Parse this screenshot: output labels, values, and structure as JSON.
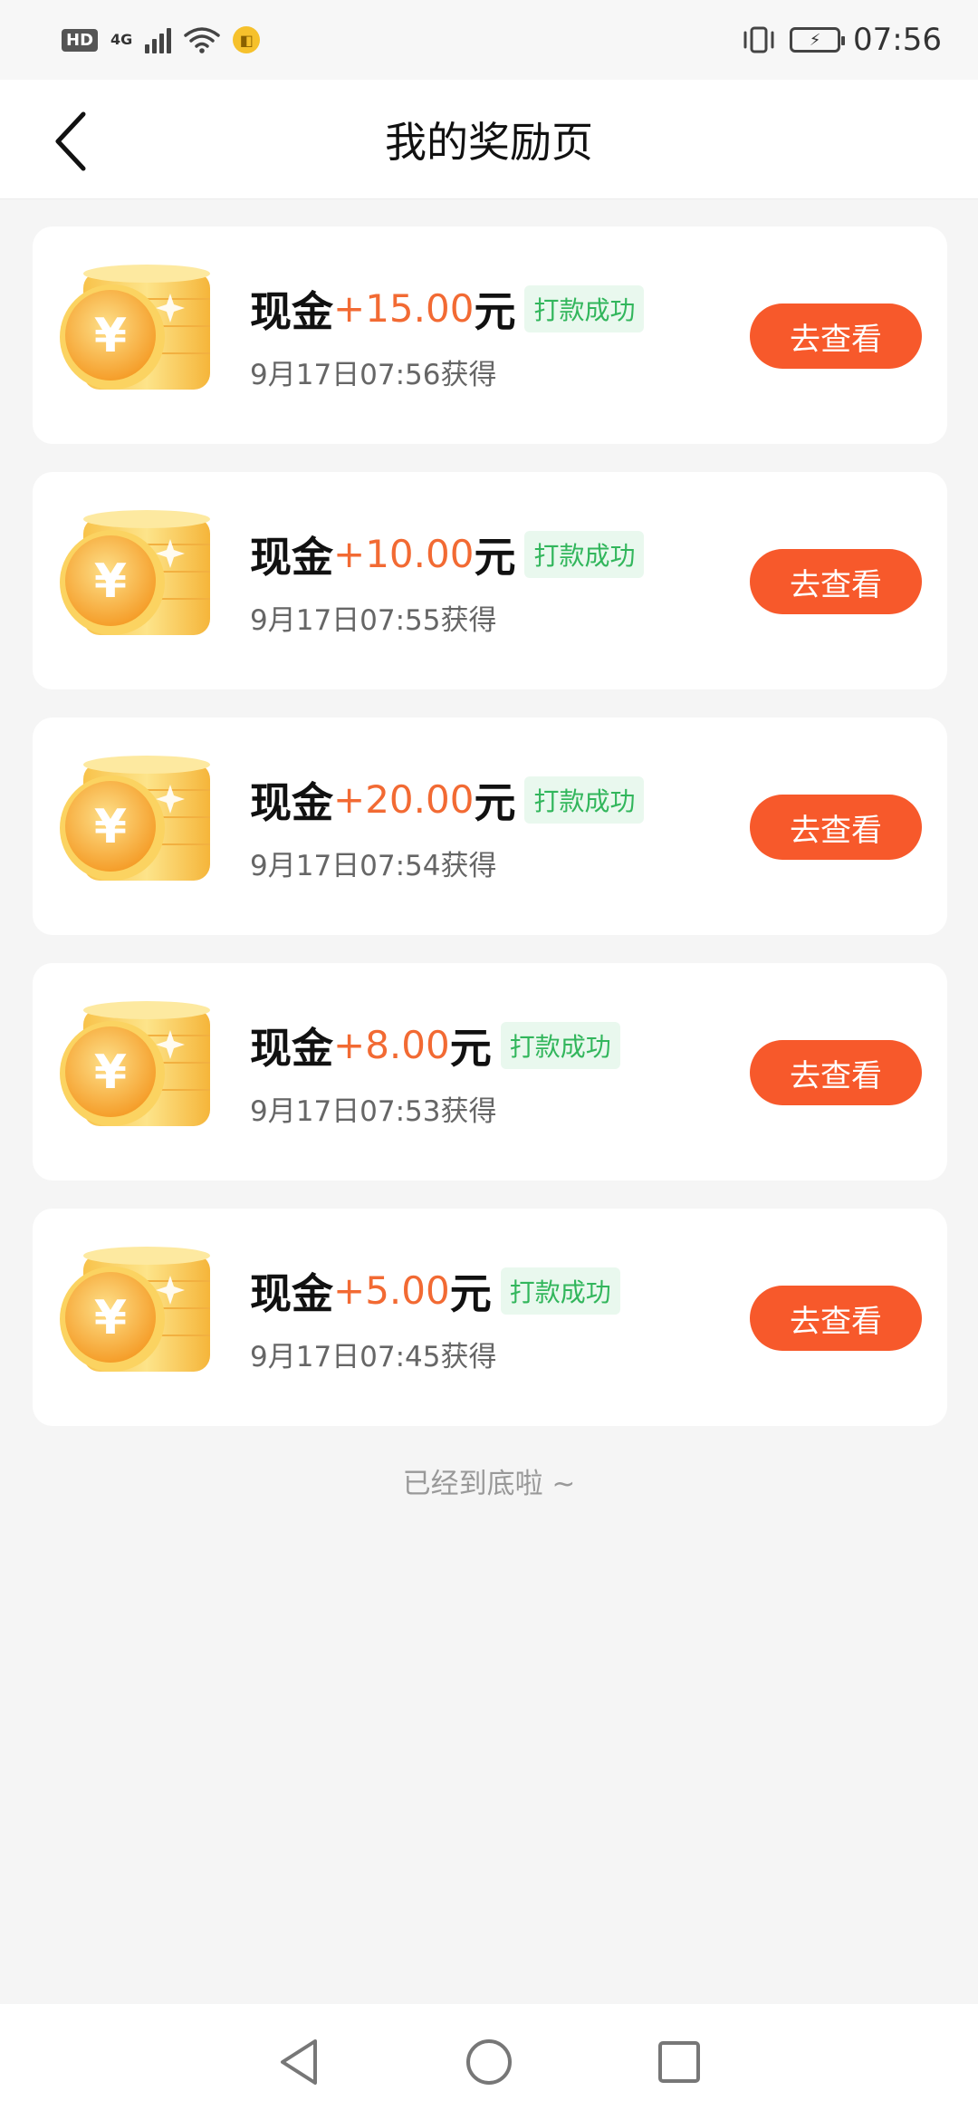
{
  "status_bar": {
    "hd": "HD",
    "network": "4G",
    "app_icon": "clone-app-icon",
    "time": "07:56",
    "icons": [
      "vibrate-icon",
      "battery-charging-icon"
    ]
  },
  "nav": {
    "back_icon": "back-chevron-icon",
    "title": "我的奖励页"
  },
  "rewards": [
    {
      "label": "现金",
      "amount": "+15.00",
      "unit": "元",
      "status": "打款成功",
      "time": "9月17日07:56获得",
      "button": "去查看"
    },
    {
      "label": "现金",
      "amount": "+10.00",
      "unit": "元",
      "status": "打款成功",
      "time": "9月17日07:55获得",
      "button": "去查看"
    },
    {
      "label": "现金",
      "amount": "+20.00",
      "unit": "元",
      "status": "打款成功",
      "time": "9月17日07:54获得",
      "button": "去查看"
    },
    {
      "label": "现金",
      "amount": "+8.00",
      "unit": "元",
      "status": "打款成功",
      "time": "9月17日07:53获得",
      "button": "去查看"
    },
    {
      "label": "现金",
      "amount": "+5.00",
      "unit": "元",
      "status": "打款成功",
      "time": "9月17日07:45获得",
      "button": "去查看"
    }
  ],
  "end_text": "已经到底啦 ~",
  "colors": {
    "accent": "#f7592b",
    "amount": "#f26a33",
    "success": "#32b65c",
    "coin": "#f7b733"
  },
  "system_nav": [
    "back-triangle-icon",
    "home-circle-icon",
    "recents-square-icon"
  ]
}
